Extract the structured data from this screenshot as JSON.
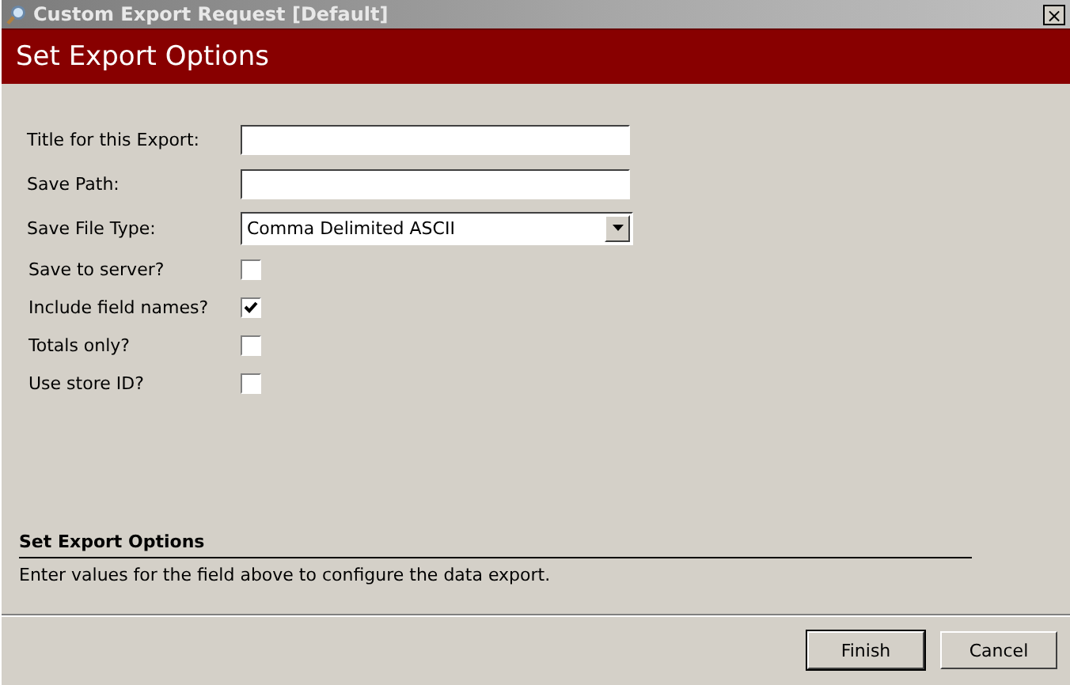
{
  "window": {
    "title": "Custom Export Request [Default]",
    "close": "×"
  },
  "header": {
    "title": "Set Export Options"
  },
  "fields": [
    {
      "kind": "text",
      "label": "Title for this Export:"
    },
    {
      "kind": "text",
      "label": "Save Path:"
    },
    {
      "kind": "select",
      "label": "Save File Type:",
      "value": "Comma Delimited ASCII"
    }
  ],
  "options": [
    {
      "label": "Save to server?",
      "checked": false
    },
    {
      "label": "Include field names?",
      "checked": true
    },
    {
      "label": "Totals only?",
      "checked": false
    },
    {
      "label": "Use store ID?",
      "checked": false
    }
  ],
  "help": {
    "title": "Set Export Options",
    "text": "Enter values for the field above to configure the data export."
  },
  "buttons": [
    {
      "label": "Finish",
      "default": true
    },
    {
      "label": "Cancel",
      "default": false
    }
  ]
}
